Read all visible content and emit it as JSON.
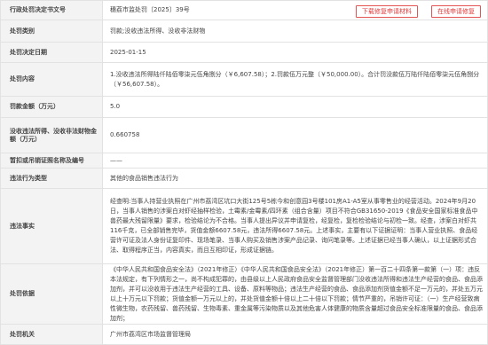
{
  "rows": [
    {
      "label": "行政处罚决定书文号",
      "value": "穗荔市监处罚〔2025〕39号"
    },
    {
      "label": "处罚类别",
      "value": "罚款;没收违法所得、没收非法财物"
    },
    {
      "label": "处罚决定日期",
      "value": "2025-01-15"
    },
    {
      "label": "处罚内容",
      "value": "1.没收违法所得陆仟陆佰零柒元伍角捌分（￥6,607.58）；2.罚款伍万元整（￥50,000.00）。合计罚没款伍万陆仟陆佰零柒元伍角捌分（￥56,607.58）。"
    },
    {
      "label": "罚款金额（万元）",
      "value": "5.0"
    },
    {
      "label": "没收违法所得、没收非法财物金额（万元）",
      "value": "0.660758"
    },
    {
      "label": "暂扣或吊销证照名称及编号",
      "value": "——"
    },
    {
      "label": "违法行为类型",
      "value": "其他的食品销售违法行为"
    },
    {
      "label": "违法事实",
      "value": "经查明:当事人持营业执照在广州市荔湾区坑口大街125号5栋今和创意园3号楼101房A1-A5室从事零售业的经营活动。2024年9月20日，当事人销售的涉案白对虾经抽样检验，土霉素/金霉素/四环素（组合含量）项目不符合GB31650-2019《食品安全国家标准食品中兽药最大残留限量》要求，检验结论为不合格。当事人提出异议并申请复检，经复检，复检检验结论与初检一致。经查，涉案白对虾共116千克，已全部销售完毕，货值金额6607.58元，违法所得6607.58元。上述事实，主要有以下证据证明：当事人营业执照、食品经营许可证及法人身份证复印件、现场笔录、当事人购买及销售涉案产品记录、询问笔录等。上述证据已经当事人确认，以上证据形式合法、取得程序正当，内容真实，而且互相印证，形成证据链。"
    },
    {
      "label": "处罚依据",
      "value": "《中华人民共和国食品安全法》（2021年修正）《中华人民共和国食品安全法》（2021年修正）第一百二十四条第一款第（一）项：违反本法规定，有下列情形之一，尚不构成犯罪的，由县级以上人民政府食品安全监督管理部门没收违法所得和违法生产经营的食品、食品添加剂，并可以没收用于违法生产经营的工具、设备、原料等物品；违法生产经营的食品、食品添加剂货值金额不足一万元的，并处五万元以上十万元以下罚款；货值金额一万元以上的，并处货值金额十倍以上二十倍以下罚款；情节严重的，吊销许可证：（一）生产经营致病性微生物，农药残留、兽药残留、生物毒素、重金属等污染物质以及其他危害人体健康的物质含量超过食品安全标准限量的食品、食品添加剂；"
    },
    {
      "label": "处罚机关",
      "value": "广州市荔湾区市场监督管理局"
    }
  ],
  "buttons": {
    "download": "下载修复申请材料",
    "apply": "在线申请修复"
  }
}
